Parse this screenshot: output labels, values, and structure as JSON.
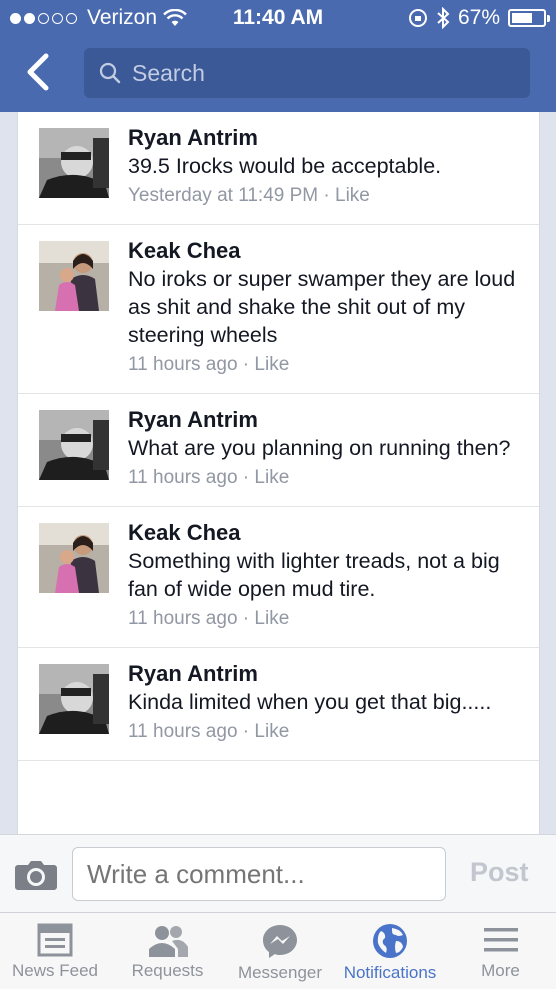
{
  "status_bar": {
    "carrier": "Verizon",
    "time": "11:40 AM",
    "battery": "67%",
    "battery_level": 0.67
  },
  "search": {
    "placeholder": "Search"
  },
  "comments": [
    {
      "author": "Ryan Antrim",
      "text": "39.5 Irocks would be acceptable.",
      "time": "Yesterday at 11:49 PM",
      "like": "Like"
    },
    {
      "author": "Keak Chea",
      "text": "No iroks or super swamper they are loud as shit and shake the shit out of my steering wheels",
      "time": "11 hours ago",
      "like": "Like"
    },
    {
      "author": "Ryan Antrim",
      "text": "What are you planning on running then?",
      "time": "11 hours ago",
      "like": "Like"
    },
    {
      "author": "Keak Chea",
      "text": "Something with lighter treads, not a big fan of wide open mud tire.",
      "time": "11 hours ago",
      "like": "Like"
    },
    {
      "author": "Ryan Antrim",
      "text": "Kinda limited when you get that big.....",
      "time": "11 hours ago",
      "like": "Like"
    }
  ],
  "composer": {
    "placeholder": "Write a comment...",
    "post_label": "Post"
  },
  "tabs": [
    {
      "label": "News Feed",
      "icon": "news-feed-icon"
    },
    {
      "label": "Requests",
      "icon": "friend-requests-icon"
    },
    {
      "label": "Messenger",
      "icon": "messenger-icon"
    },
    {
      "label": "Notifications",
      "icon": "globe-icon",
      "active": true
    },
    {
      "label": "More",
      "icon": "menu-icon"
    }
  ],
  "colors": {
    "header": "#4a6ab0",
    "active_tab": "#4a74c9"
  }
}
